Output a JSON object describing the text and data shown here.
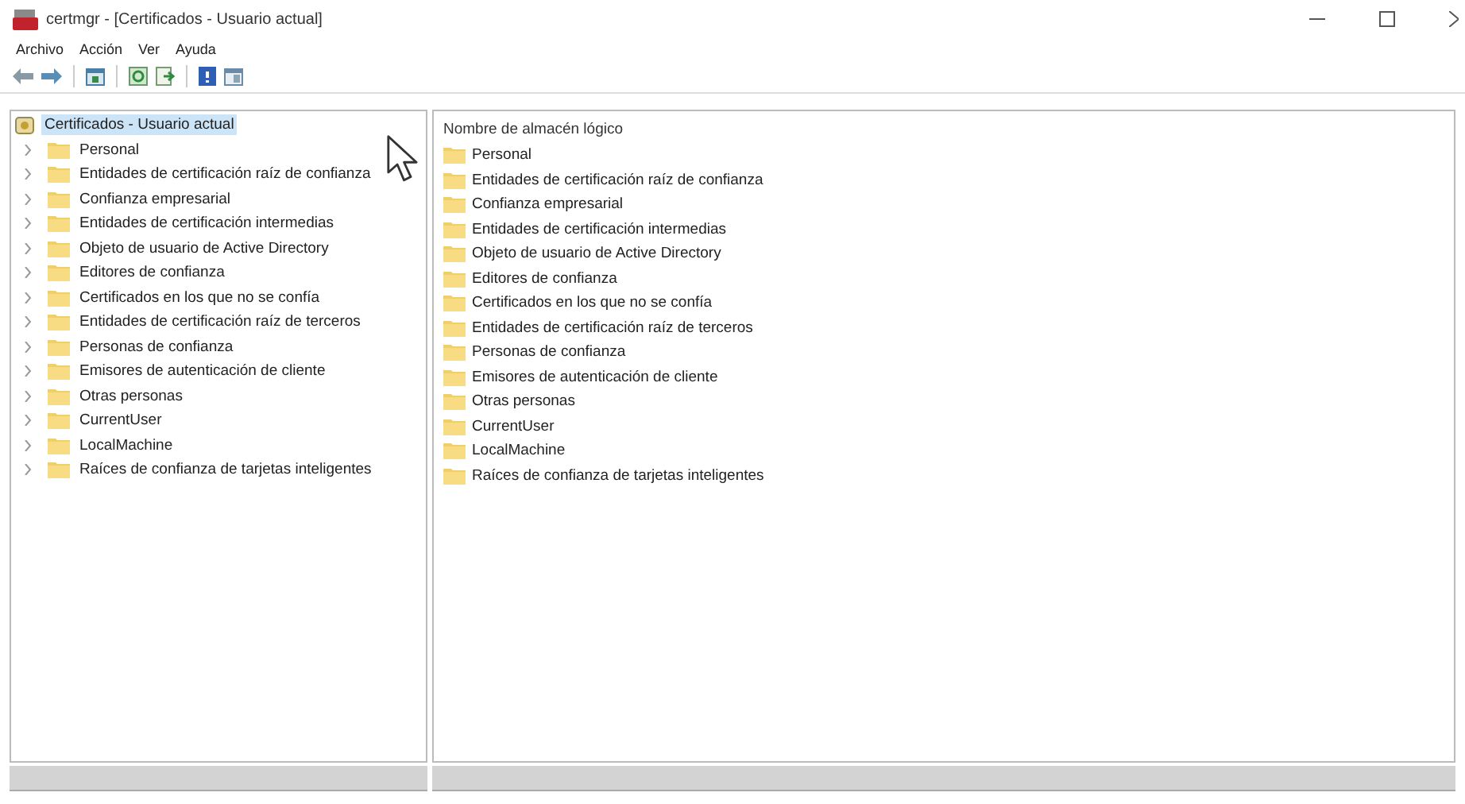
{
  "window": {
    "title": "certmgr - [Certificados - Usuario actual]"
  },
  "menu": [
    "Archivo",
    "Acción",
    "Ver",
    "Ayuda"
  ],
  "tree": {
    "label": "Certificados - Usuario actual",
    "selected": true,
    "children": [
      {
        "label": "Personal",
        "expanded": false
      },
      {
        "label": "Entidades de certificación raíz de confianza",
        "expanded": false
      },
      {
        "label": "Confianza empresarial",
        "expanded": false
      },
      {
        "label": "Entidades de certificación intermedias",
        "expanded": false
      },
      {
        "label": "Objeto de usuario de Active Directory",
        "expanded": false
      },
      {
        "label": "Editores de confianza",
        "expanded": false
      },
      {
        "label": "Certificados en los que no se confía",
        "expanded": false
      },
      {
        "label": "Entidades de certificación raíz de terceros",
        "expanded": false
      },
      {
        "label": "Personas de confianza",
        "expanded": false
      },
      {
        "label": "Emisores de autenticación de cliente",
        "expanded": false
      },
      {
        "label": "Otras personas",
        "expanded": false
      },
      {
        "label": "CurrentUser",
        "expanded": false
      },
      {
        "label": "LocalMachine",
        "expanded": false
      },
      {
        "label": "Raíces de confianza de tarjetas inteligentes",
        "expanded": false
      }
    ]
  },
  "list": {
    "columns": [
      "Nombre de almacén lógico"
    ],
    "rows": [
      "Personal",
      "Entidades de certificación raíz de confianza",
      "Confianza empresarial",
      "Entidades de certificación intermedias",
      "Objeto de usuario de Active Directory",
      "Editores de confianza",
      "Certificados en los que no se confía",
      "Entidades de certificación raíz de terceros",
      "Personas de confianza",
      "Emisores de autenticación de cliente",
      "Otras personas",
      "CurrentUser",
      "LocalMachine",
      "Raíces de confianza de tarjetas inteligentes"
    ]
  }
}
